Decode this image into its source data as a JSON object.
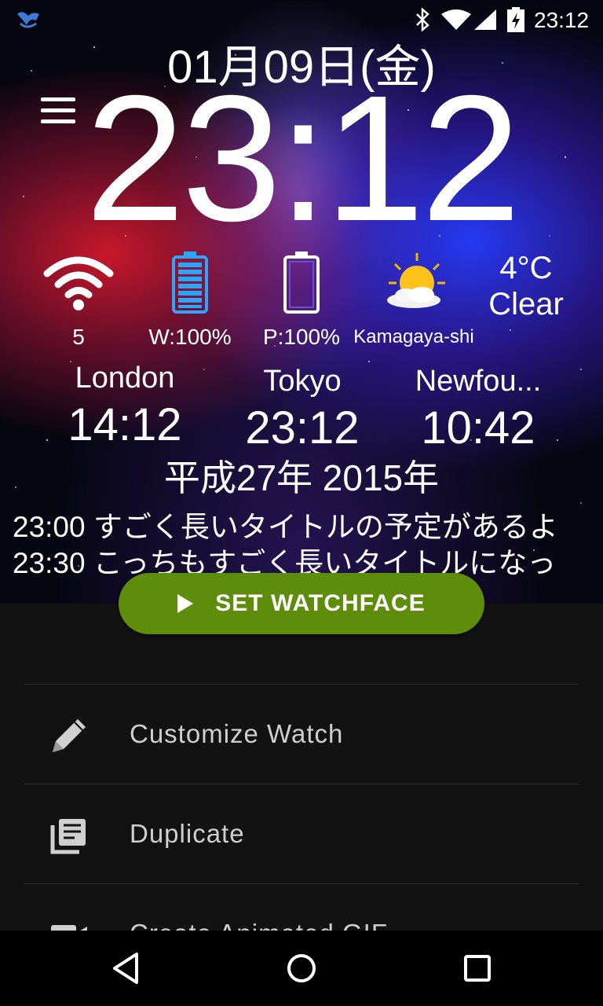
{
  "status_bar": {
    "time": "23:12"
  },
  "watchface": {
    "date": "01月09日(金)",
    "time": "23:12",
    "wifi_count": "5",
    "watch_battery": "W:100%",
    "phone_battery": "P:100%",
    "location": "Kamagaya-shi",
    "temperature": "4°C",
    "condition": "Clear",
    "cities": [
      {
        "name": "London",
        "time": "14:12"
      },
      {
        "name": "Tokyo",
        "time": "23:12"
      },
      {
        "name": "Newfou...",
        "time": "10:42"
      }
    ],
    "era": "平成27年 2015年",
    "events": [
      "23:00 すごく長いタイトルの予定があるよ",
      "23:30 こっちもすごく長いタイトルになっ"
    ]
  },
  "set_watchface_label": "SET WATCHFACE",
  "menu_items": [
    {
      "label": "Customize Watch",
      "icon": "pencil-icon"
    },
    {
      "label": "Duplicate",
      "icon": "duplicate-icon"
    },
    {
      "label": "Create Animated GIF",
      "icon": "video-icon"
    }
  ],
  "colors": {
    "accent": "#5e8c0b",
    "background": "#121212"
  }
}
